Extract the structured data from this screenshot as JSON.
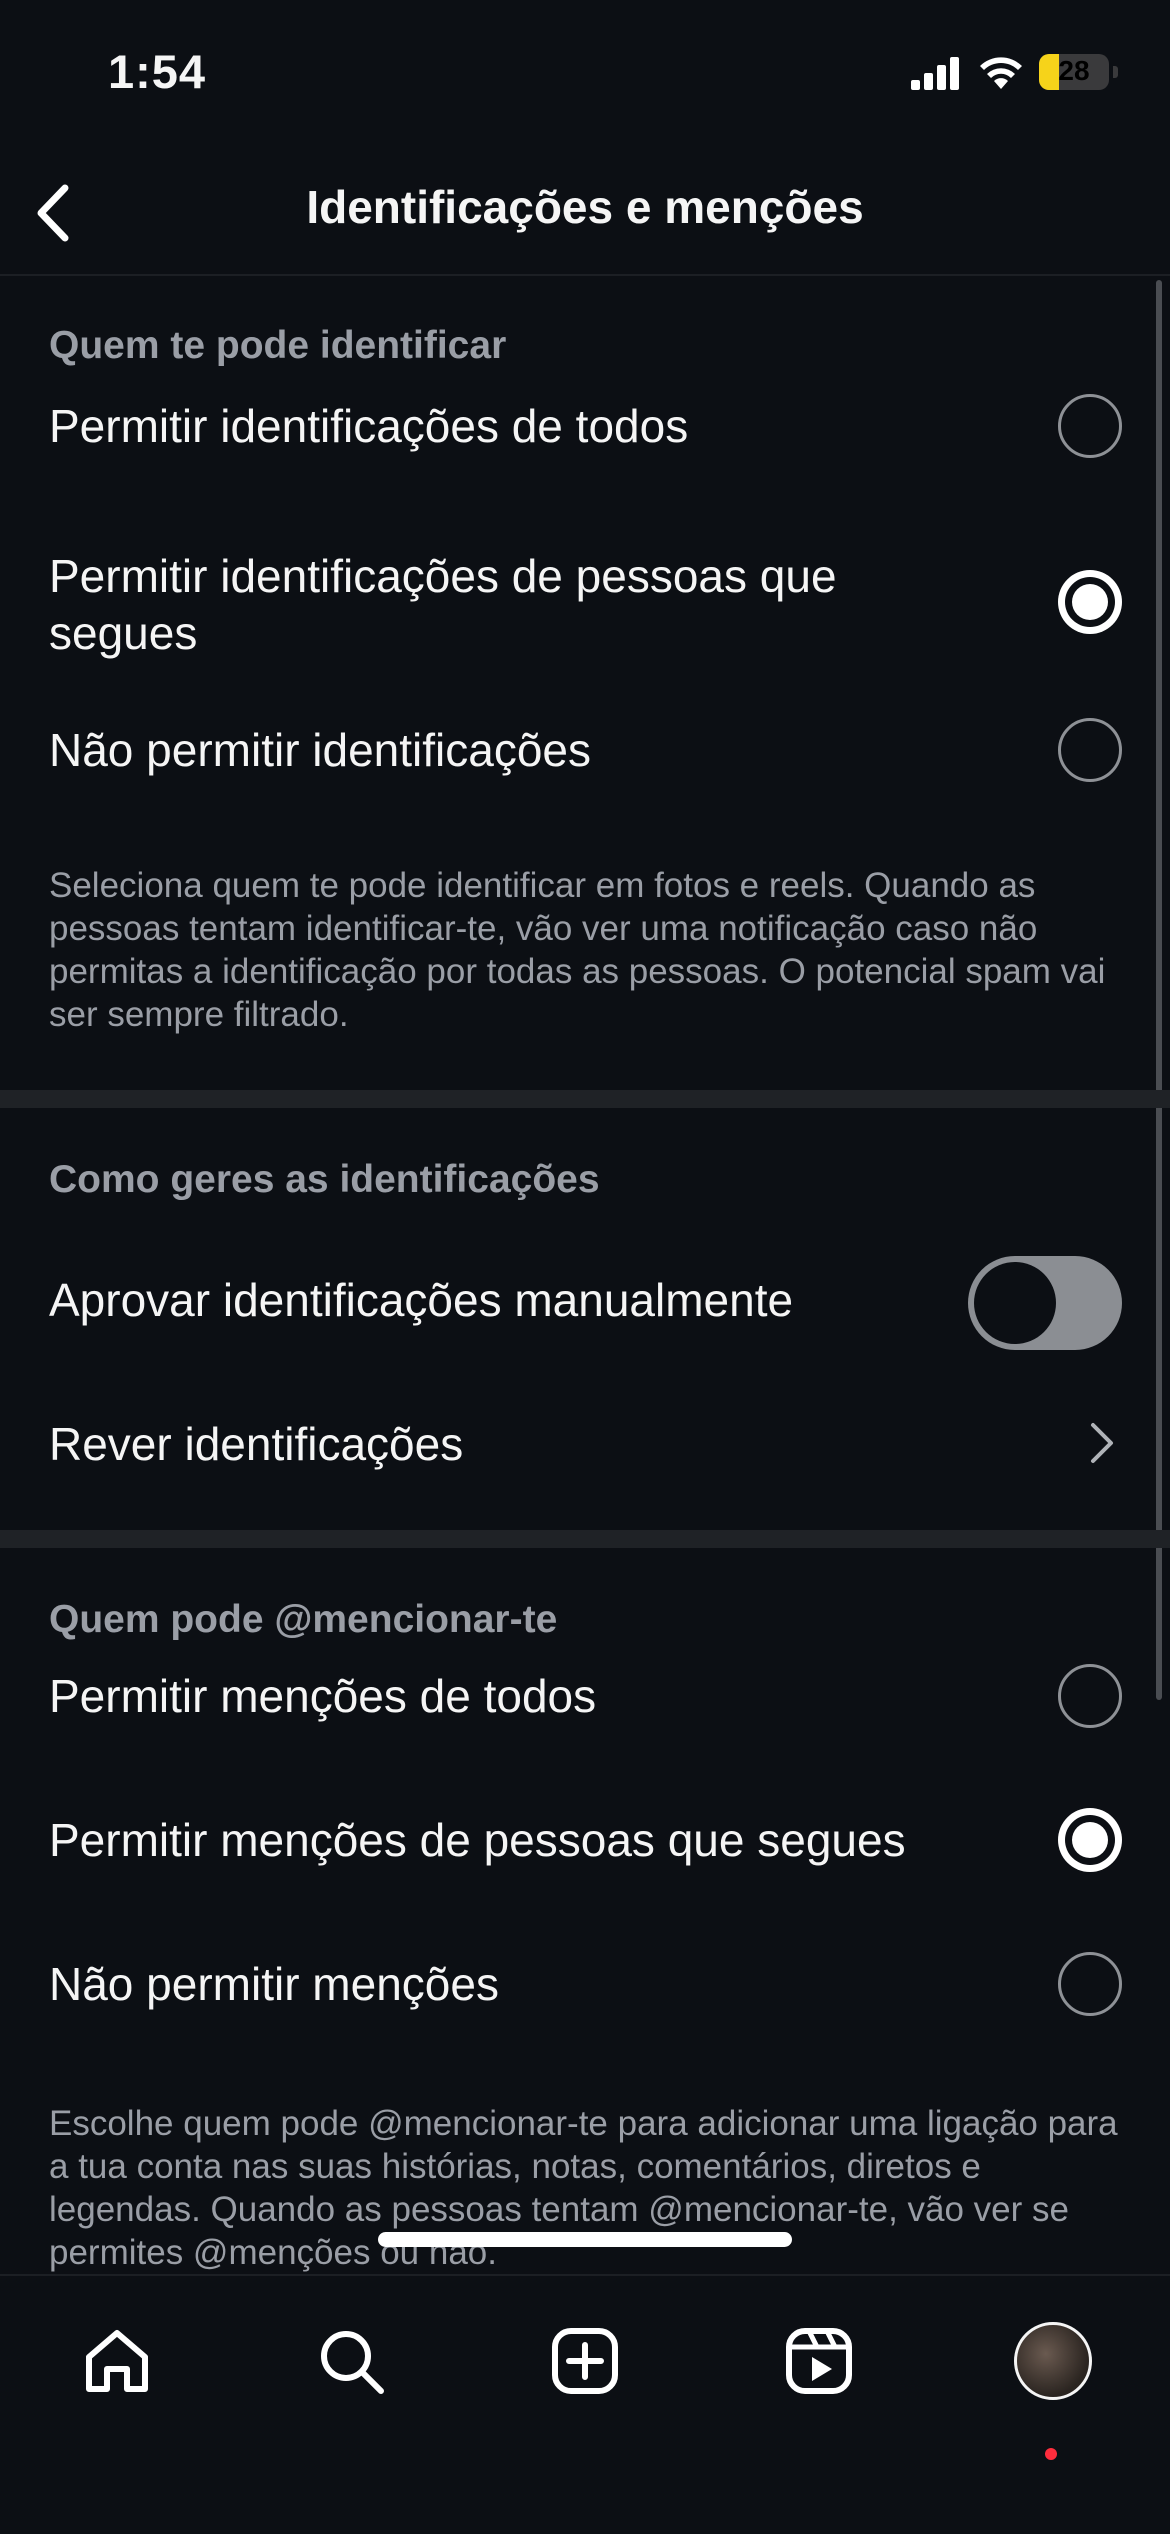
{
  "status": {
    "time": "1:54",
    "battery": "28",
    "battery_level": 0.28
  },
  "nav": {
    "title": "Identificações e menções"
  },
  "sections": {
    "tagging": {
      "header": "Quem te pode identificar",
      "options": [
        {
          "label": "Permitir identificações de todos",
          "selected": false
        },
        {
          "label": "Permitir identificações de pessoas que segues",
          "selected": true
        },
        {
          "label": "Não permitir identificações",
          "selected": false
        }
      ],
      "description": "Seleciona quem te pode identificar em fotos e reels. Quando as pessoas tentam identificar-te, vão ver uma notificação caso não permitas a identificação por todas as pessoas. O potencial spam vai ser sempre filtrado."
    },
    "manage": {
      "header": "Como geres as identificações",
      "manual_approval": {
        "label": "Aprovar identificações manualmente",
        "enabled": false
      },
      "review": {
        "label": "Rever identificações"
      }
    },
    "mentions": {
      "header": "Quem pode @mencionar-te",
      "options": [
        {
          "label": "Permitir menções de todos",
          "selected": false
        },
        {
          "label": "Permitir menções de pessoas que segues",
          "selected": true
        },
        {
          "label": "Não permitir menções",
          "selected": false
        }
      ],
      "description": "Escolhe quem pode @mencionar-te para adicionar uma ligação para a tua conta nas suas histórias, notas, comentários, diretos e legendas. Quando as pessoas tentam @mencionar-te, vão ver se permites @menções ou não."
    }
  },
  "tabbar": {
    "items": [
      "home-icon",
      "search-icon",
      "create-icon",
      "reels-icon",
      "profile-avatar"
    ],
    "notification_color": "#ff2d3d"
  },
  "colors": {
    "background": "#0c0f14",
    "text": "#f5f5f5",
    "muted": "#9a9ea6"
  }
}
